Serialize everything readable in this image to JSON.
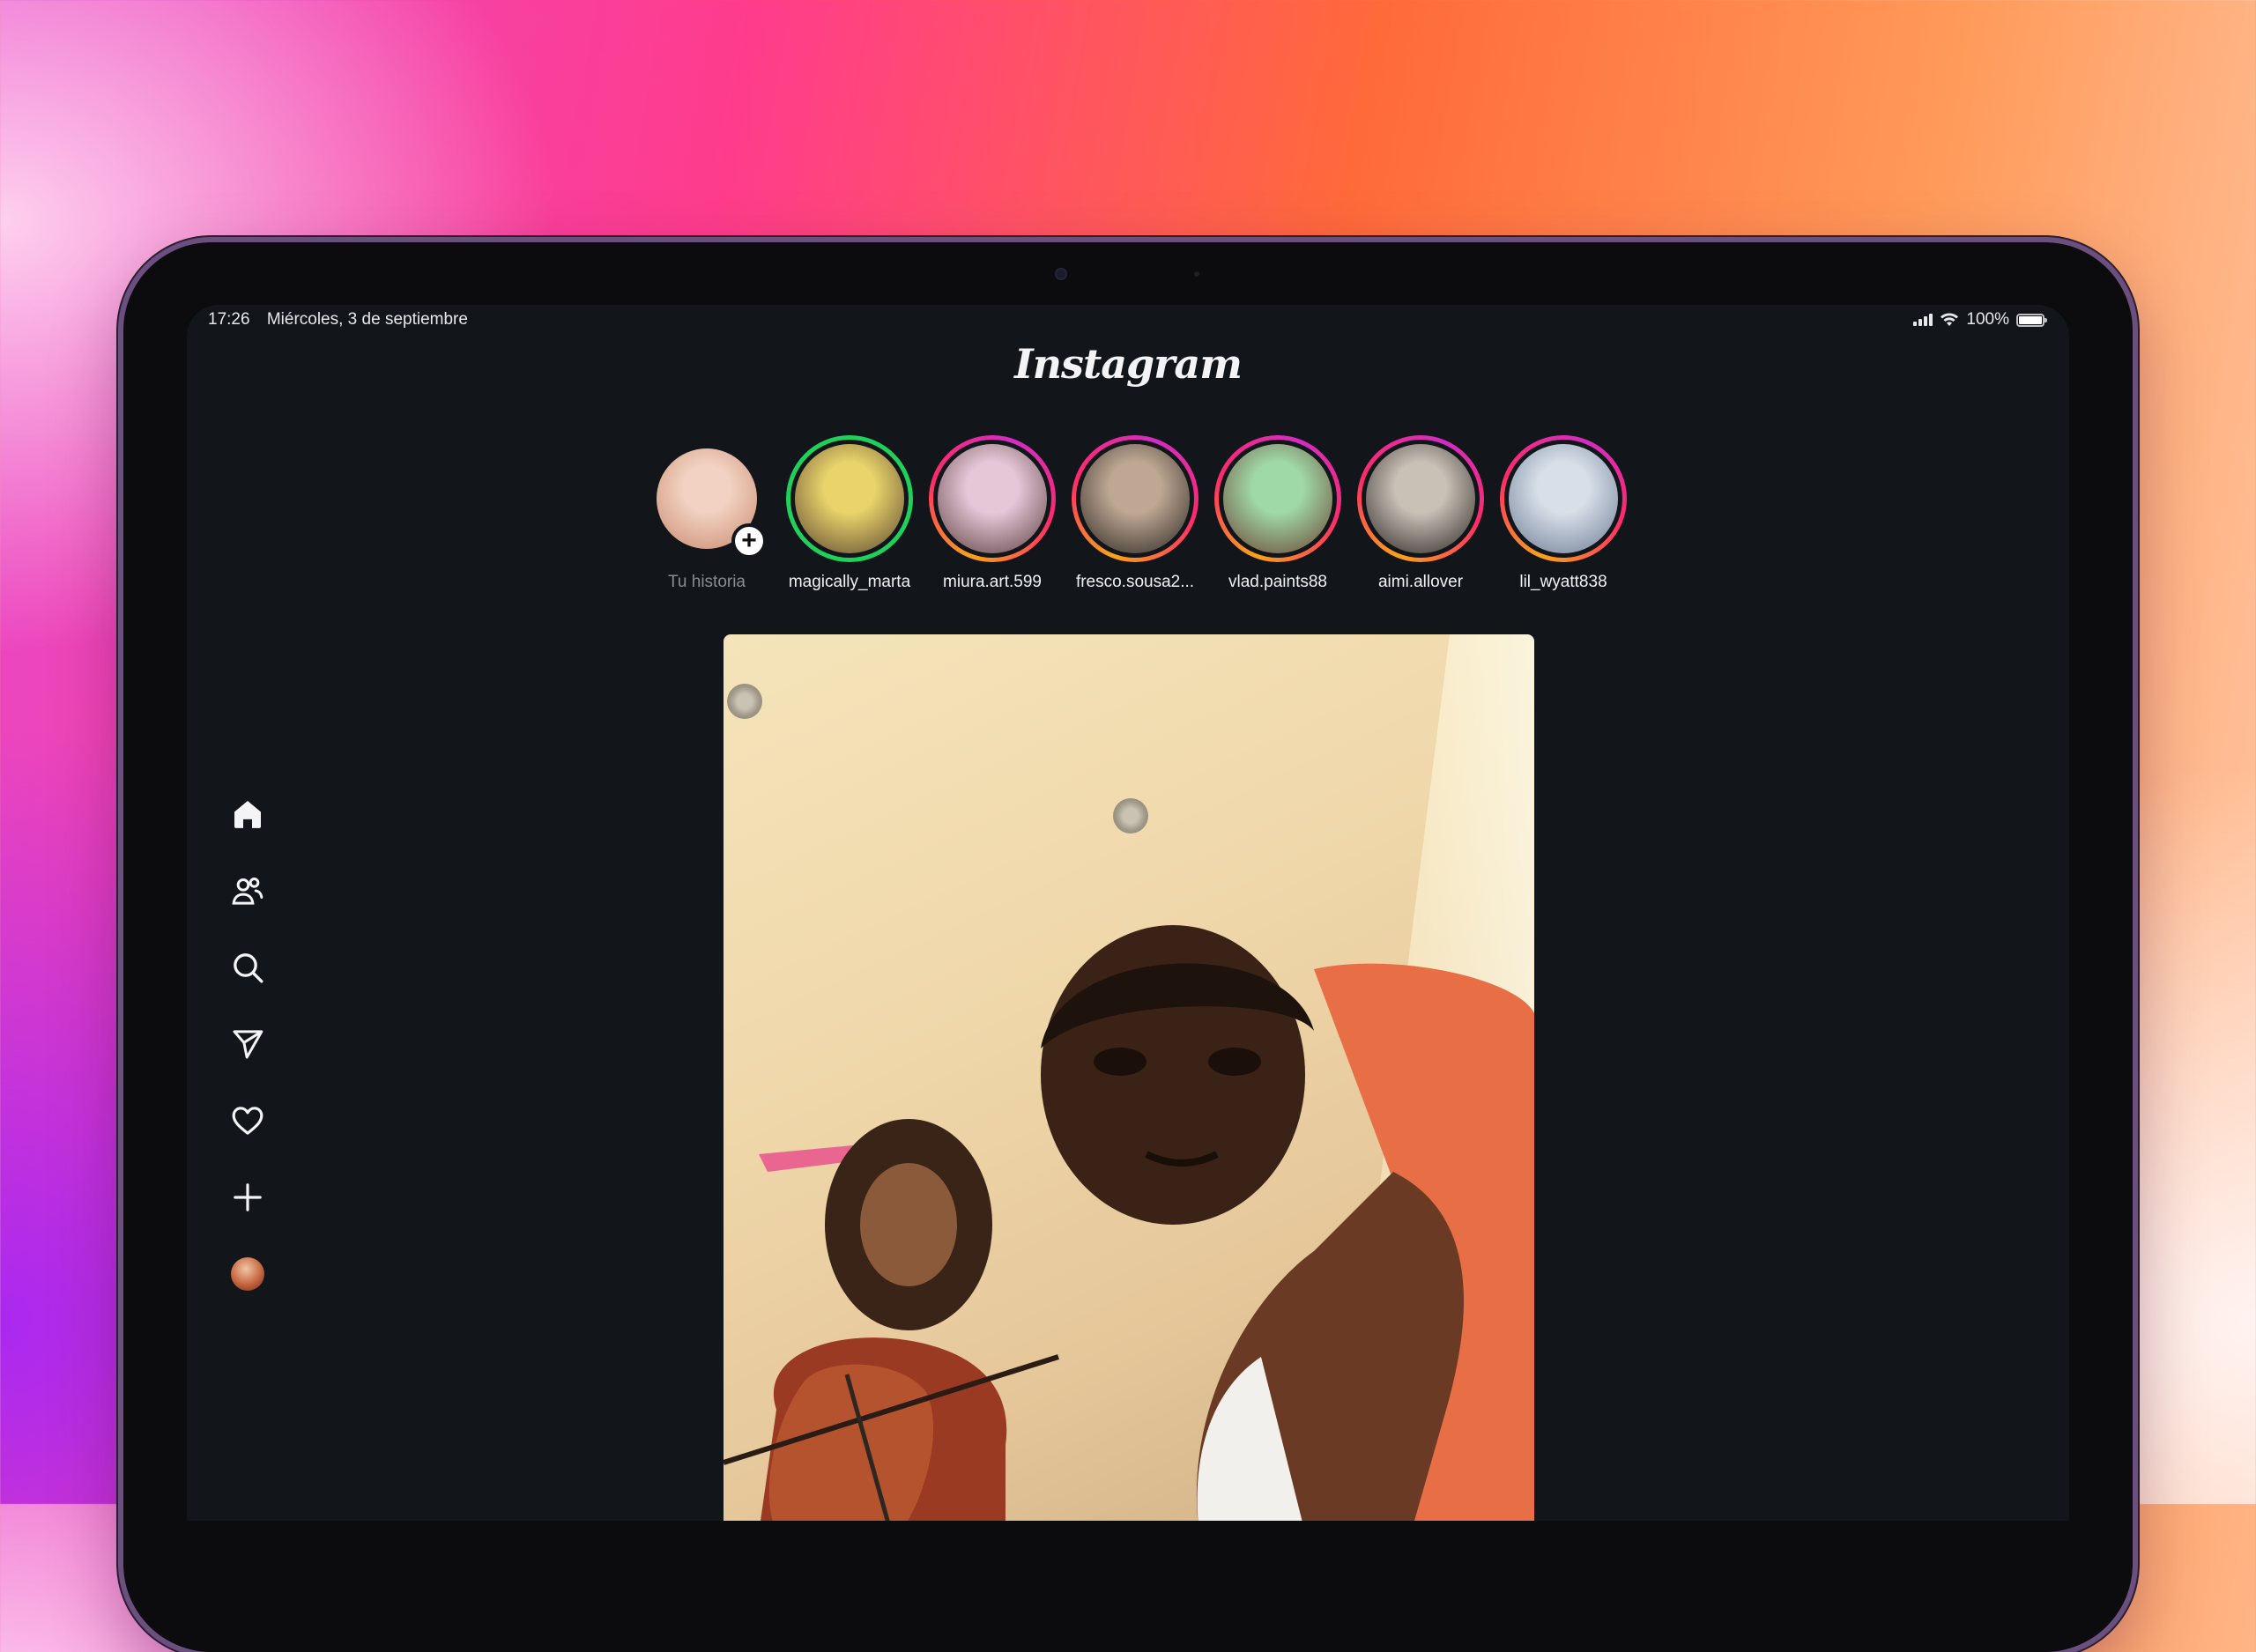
{
  "status_bar": {
    "time": "17:26",
    "date": "Miércoles, 3 de septiembre",
    "battery": "100%"
  },
  "header": {
    "title": "Instagram"
  },
  "stories": [
    {
      "username": "Tu historia",
      "type": "own",
      "colors": [
        "#f2d2c2",
        "#c98a6e"
      ]
    },
    {
      "username": "magically_marta",
      "type": "close_friends",
      "colors": [
        "#e9d36a",
        "#5a4632"
      ]
    },
    {
      "username": "miura.art.599",
      "type": "unseen",
      "colors": [
        "#e6c7d8",
        "#5c4040"
      ]
    },
    {
      "username": "fresco.sousa2...",
      "type": "unseen",
      "colors": [
        "#bfa893",
        "#2a2622"
      ]
    },
    {
      "username": "vlad.paints88",
      "type": "unseen",
      "colors": [
        "#9fd9a8",
        "#6b4030"
      ]
    },
    {
      "username": "aimi.allover",
      "type": "unseen",
      "colors": [
        "#c9c0b6",
        "#2b2724"
      ]
    },
    {
      "username": "lil_wyatt838",
      "type": "unseen",
      "colors": [
        "#d7dfe8",
        "#6d7c94"
      ]
    }
  ],
  "sidebar": {
    "items": [
      {
        "name": "home",
        "icon": "home-icon"
      },
      {
        "name": "friends",
        "icon": "people-icon"
      },
      {
        "name": "search",
        "icon": "search-icon"
      },
      {
        "name": "messages",
        "icon": "send-icon"
      },
      {
        "name": "activity",
        "icon": "heart-icon"
      },
      {
        "name": "create",
        "icon": "plus-icon"
      },
      {
        "name": "profile",
        "icon": "profile-avatar"
      }
    ]
  },
  "colors": {
    "screen_bg": "#121519",
    "close_friends_ring": "#1fd05a",
    "story_ring_gradient": [
      "#f9a318",
      "#ff2a6a",
      "#d22cc4"
    ],
    "text": "#f1f1f3",
    "muted_text": "#8a8c92"
  }
}
